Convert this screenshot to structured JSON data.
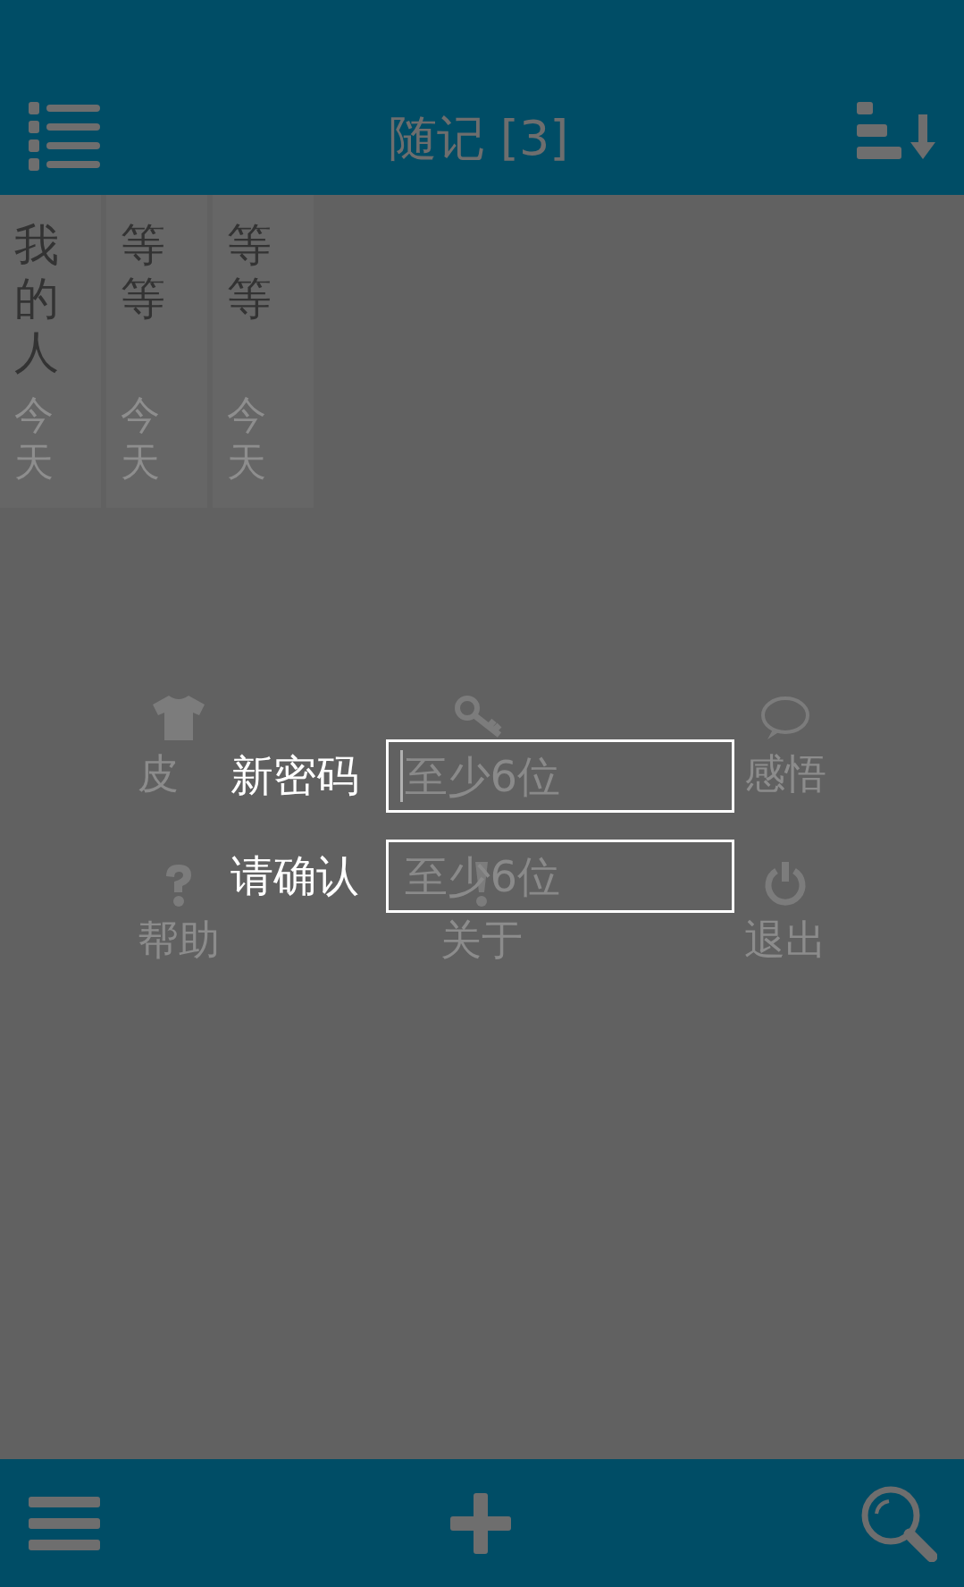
{
  "header": {
    "title": "随记 [3]"
  },
  "notes": [
    {
      "title": "我的人",
      "date": "今天"
    },
    {
      "title": "等等",
      "date": "今天"
    },
    {
      "title": "等等",
      "date": "今天"
    }
  ],
  "menu": [
    {
      "kind": "shirt",
      "label": "皮"
    },
    {
      "kind": "key"
    },
    {
      "kind": "bubble",
      "label": "感悟"
    },
    {
      "kind": "help",
      "label": "帮助"
    },
    {
      "kind": "info",
      "label": "关于"
    },
    {
      "kind": "power",
      "label": "退出"
    }
  ],
  "dialog": {
    "fields": [
      {
        "label": "新密码",
        "placeholder": "至少6位",
        "focused": true
      },
      {
        "label": "请确认",
        "placeholder": "至少6位",
        "focused": false
      }
    ]
  }
}
